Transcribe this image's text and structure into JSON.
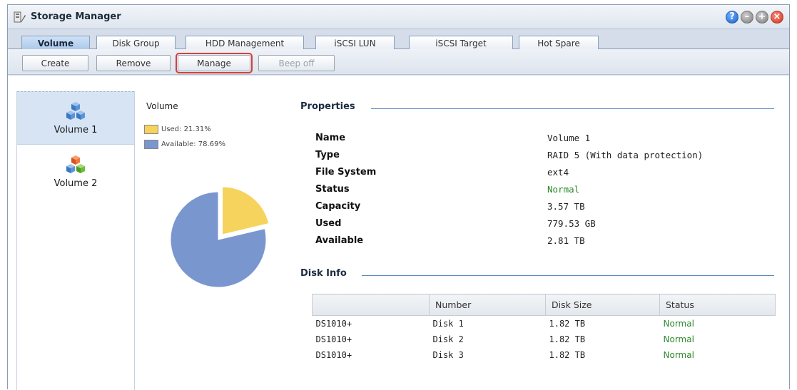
{
  "window": {
    "title": "Storage Manager"
  },
  "tabs": [
    {
      "label": "Volume"
    },
    {
      "label": "Disk Group"
    },
    {
      "label": "HDD Management"
    },
    {
      "label": "iSCSI LUN"
    },
    {
      "label": "iSCSI Target"
    },
    {
      "label": "Hot Spare"
    }
  ],
  "toolbar": {
    "create": "Create",
    "remove": "Remove",
    "manage": "Manage",
    "beep_off": "Beep off"
  },
  "sidebar": {
    "items": [
      {
        "label": "Volume 1",
        "selected": true
      },
      {
        "label": "Volume 2",
        "selected": false
      }
    ]
  },
  "volume_panel": {
    "title": "Volume",
    "legend": [
      {
        "label": "Used: 21.31%",
        "color": "#f5d35c"
      },
      {
        "label": "Available: 78.69%",
        "color": "#7996cf"
      }
    ]
  },
  "chart_data": {
    "type": "pie",
    "labels": [
      "Used",
      "Available"
    ],
    "values": [
      21.31,
      78.69
    ],
    "colors": [
      "#f5d35c",
      "#7996cf"
    ]
  },
  "properties": {
    "heading": "Properties",
    "rows": [
      {
        "key": "Name",
        "value": "Volume 1",
        "status": false
      },
      {
        "key": "Type",
        "value": "RAID 5 (With data protection)",
        "status": false
      },
      {
        "key": "File System",
        "value": "ext4",
        "status": false
      },
      {
        "key": "Status",
        "value": "Normal",
        "status": true
      },
      {
        "key": "Capacity",
        "value": "3.57 TB",
        "status": false
      },
      {
        "key": "Used",
        "value": "779.53 GB",
        "status": false
      },
      {
        "key": "Available",
        "value": "2.81 TB",
        "status": false
      }
    ]
  },
  "disk_info": {
    "heading": "Disk Info",
    "columns": [
      "",
      "Number",
      "Disk Size",
      "Status"
    ],
    "rows": [
      [
        "DS1010+",
        "Disk 1",
        "1.82 TB",
        "Normal"
      ],
      [
        "DS1010+",
        "Disk 2",
        "1.82 TB",
        "Normal"
      ],
      [
        "DS1010+",
        "Disk 3",
        "1.82 TB",
        "Normal"
      ]
    ]
  },
  "colors": {
    "status_normal": "#2b8a2b",
    "highlight": "#d7403a",
    "accent": "#5d85c0"
  }
}
